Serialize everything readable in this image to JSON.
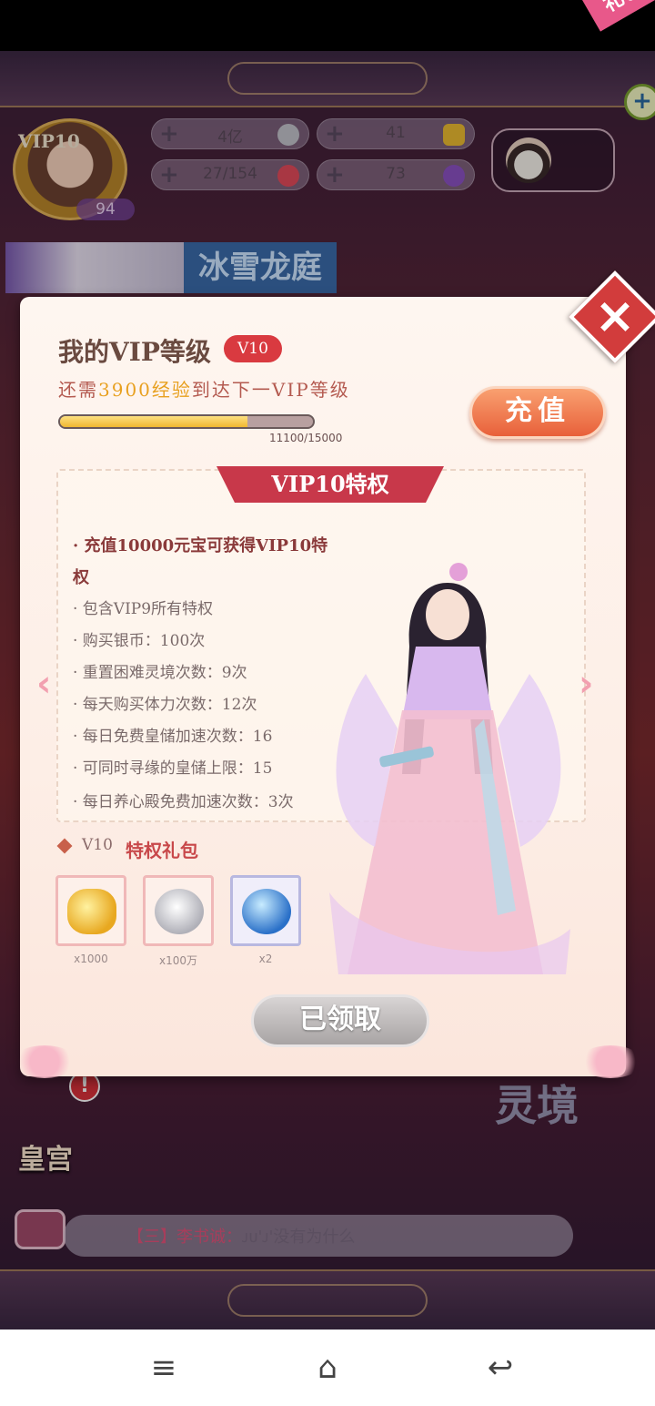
{
  "header": {
    "gift_tag": "礼包",
    "avatar_vip": "VIP10",
    "avatar_level": "94",
    "resources": [
      {
        "value": "4亿",
        "icon": "silver-coin-icon",
        "color": "#c0c0c8"
      },
      {
        "value": "41",
        "icon": "gold-ingot-icon",
        "color": "#e8b830"
      },
      {
        "value": "27/154",
        "icon": "heart-icon",
        "color": "#e04a5a"
      },
      {
        "value": "73",
        "icon": "gem-icon",
        "color": "#8a50c0"
      }
    ],
    "banner_text": "冰雪龙庭"
  },
  "background": {
    "palace_label": "皇宫",
    "palace_badge": "!",
    "realm_label": "灵境",
    "chat_prefix": "【三】李书诚：",
    "chat_text": "ᴊᴜ'ᴊ'没有为什么"
  },
  "modal": {
    "title": "我的VIP等级",
    "vip_badge": "V10",
    "need_prefix": "还需",
    "need_amount": "3900经验",
    "need_suffix": "到达下一VIP等级",
    "progress_text": "11100/15000",
    "progress": 0.74,
    "recharge_label": "充值",
    "perks_title": "VIP10特权",
    "perks": [
      "· 充值10000元宝可获得VIP10特权",
      "· 包含VIP9所有特权",
      "· 购买银币：100次",
      "· 重置困难灵境次数：9次",
      "· 每天购买体力次数：12次",
      "· 每日免费皇储加速次数：16",
      "· 可同时寻缘的皇储上限：15",
      "· 每日养心殿免费加速次数：3次"
    ],
    "gift_vip": "V10",
    "gift_title": "特权礼包",
    "gift_items": [
      {
        "icon": "gold-ingot-icon",
        "qty": "x1000"
      },
      {
        "icon": "silver-heart-coin-icon",
        "qty": "x100万"
      },
      {
        "icon": "blue-gem-icon",
        "qty": "x2"
      }
    ],
    "claimed_label": "已领取"
  },
  "nav": {
    "menu": "≡",
    "home": "⌂",
    "back": "↩"
  }
}
